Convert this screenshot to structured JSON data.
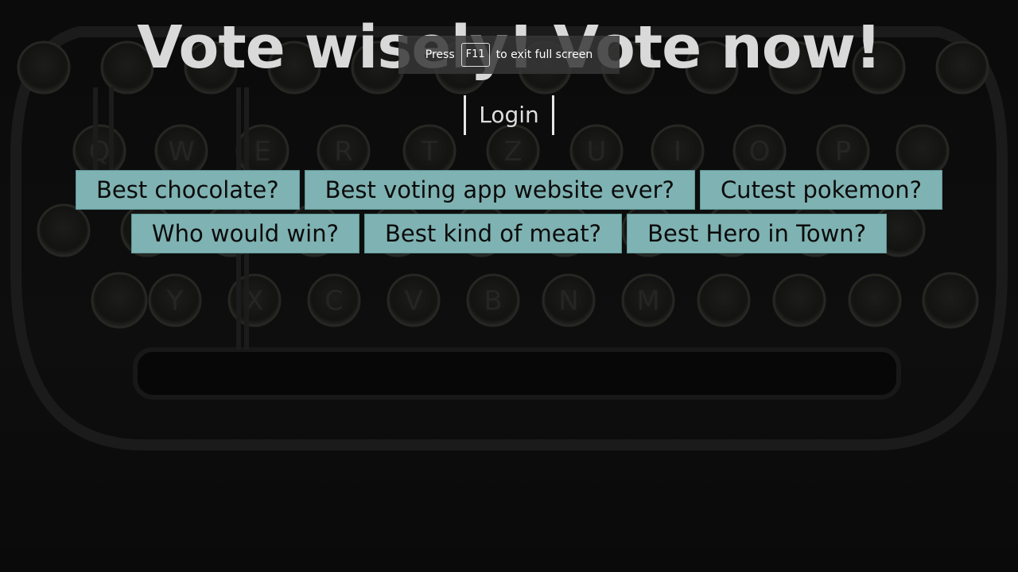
{
  "headline": "Vote wisely! Vote now!",
  "fullscreen_notice": {
    "press": "Press",
    "key": "F11",
    "suffix": "to exit full screen"
  },
  "login_label": "Login",
  "polls": [
    [
      "Best chocolate?",
      "Best voting app website ever?",
      "Cutest pokemon?"
    ],
    [
      "Who would win?",
      "Best kind of meat?",
      "Best Hero in Town?"
    ]
  ],
  "colors": {
    "poll_button_bg": "#7fb2b2",
    "headline_text": "#d9d9d9",
    "page_bg": "#0e0e0e"
  }
}
